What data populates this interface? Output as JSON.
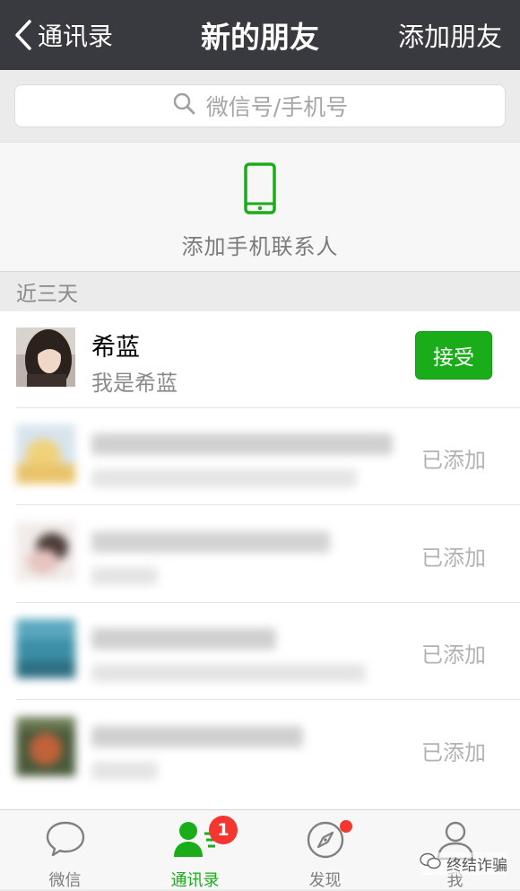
{
  "navbar": {
    "back_label": "通讯录",
    "title": "新的朋友",
    "action_label": "添加朋友"
  },
  "search": {
    "placeholder": "微信号/手机号",
    "icon": "search-icon"
  },
  "add_phone_contacts": {
    "label": "添加手机联系人",
    "icon": "phone-icon",
    "icon_color": "#1aad19"
  },
  "section": {
    "header": "近三天"
  },
  "friends": [
    {
      "name": "希蓝",
      "message": "我是希蓝",
      "action": "接受",
      "accent": "#1aad19"
    },
    {
      "status": "已添加"
    },
    {
      "status": "已添加"
    },
    {
      "status": "已添加"
    },
    {
      "status": "已添加"
    }
  ],
  "tabs": [
    {
      "label": "微信",
      "icon": "chat-bubble-icon"
    },
    {
      "label": "通讯录",
      "icon": "contacts-icon",
      "badge": "1",
      "active": true
    },
    {
      "label": "发现",
      "icon": "compass-icon",
      "has_red_dot": true
    },
    {
      "label": "我",
      "icon": "person-icon"
    }
  ],
  "watermark": {
    "text": "终结诈骗",
    "icon": "wechat-logo-icon"
  },
  "colors": {
    "navbar_bg": "#393a3f",
    "accent_green": "#1aad19",
    "badge_red": "#f43530"
  }
}
